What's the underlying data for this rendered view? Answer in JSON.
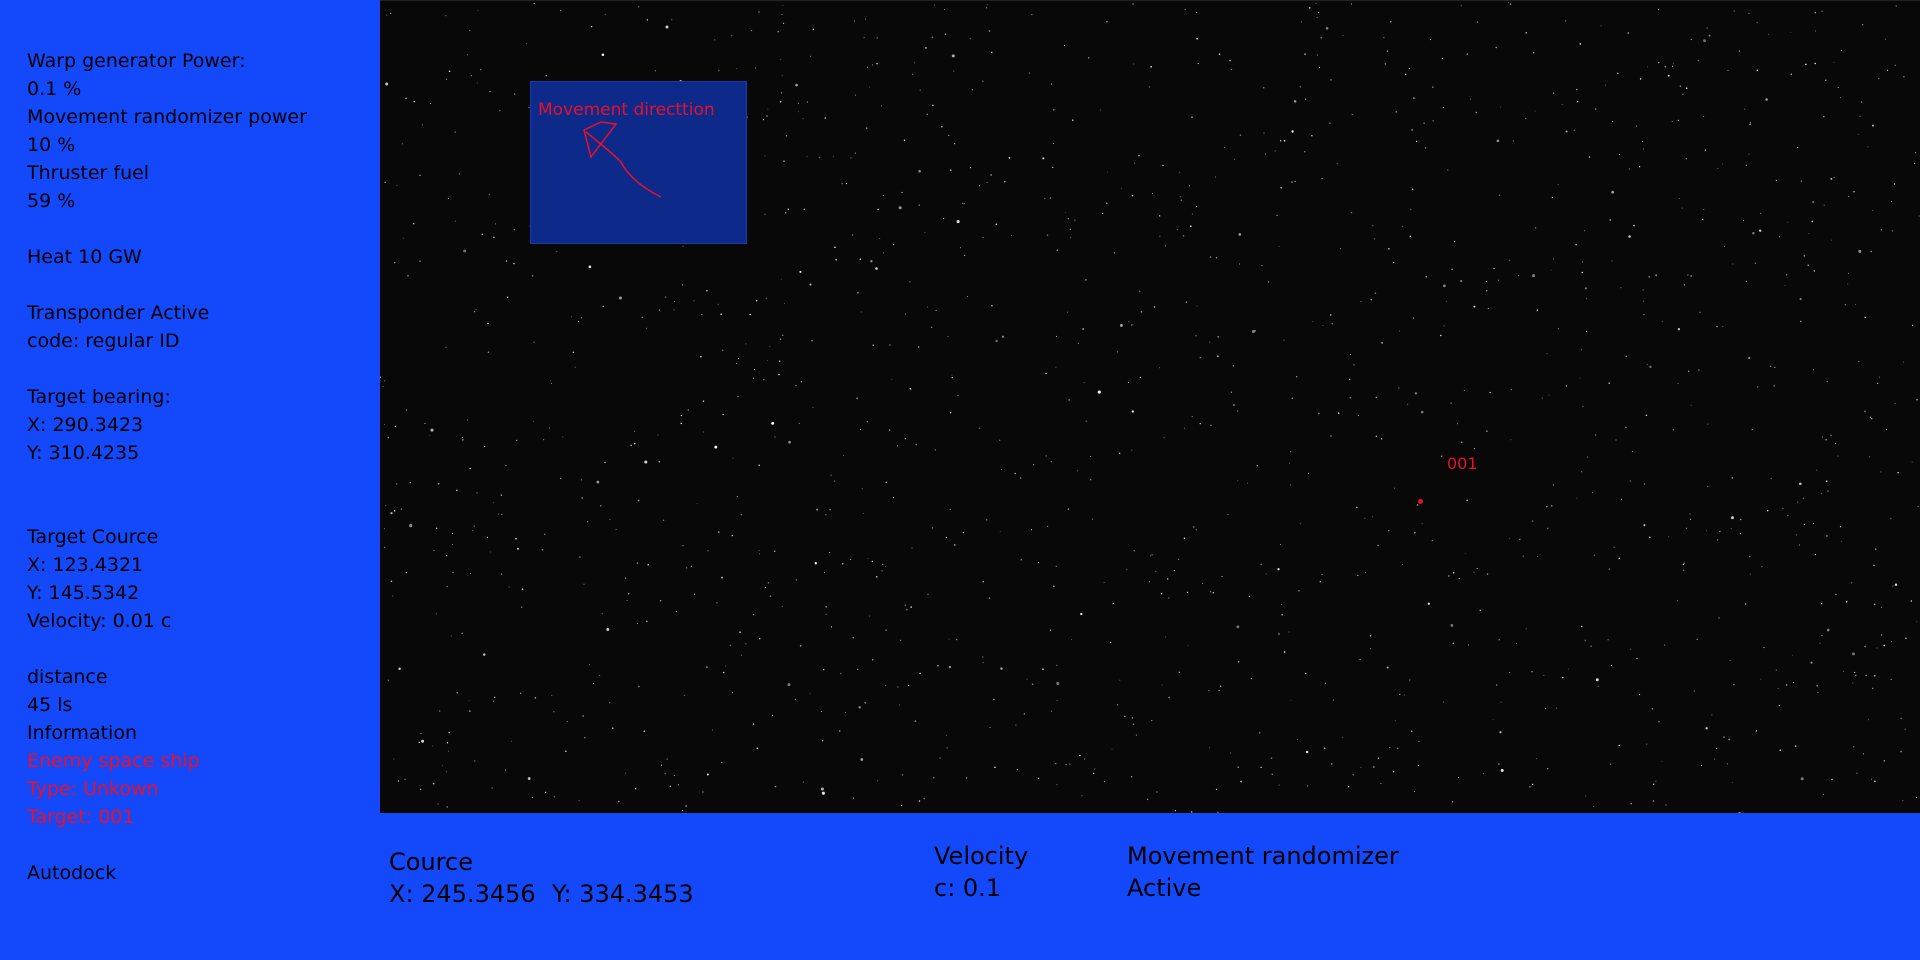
{
  "sidebar": {
    "warp_label": "Warp generator Power:",
    "warp_value": "0.1 %",
    "randomizer_label": "Movement randomizer power",
    "randomizer_value": "10 %",
    "fuel_label": "Thruster fuel",
    "fuel_value": "59 %",
    "heat": "Heat 10 GW",
    "transponder": "Transponder Active",
    "transponder_code": "code: regular ID",
    "bearing_label": "Target bearing:",
    "bearing_x": "X: 290.3423",
    "bearing_y": "Y: 310.4235",
    "course_label": "Target Cource",
    "course_x": "X: 123.4321",
    "course_y": "Y: 145.5342",
    "course_velocity": "Velocity: 0.01 c",
    "distance_label": "distance",
    "distance_value": "45 ls",
    "info_label": "Information",
    "info_ship": "Enemy space ship",
    "info_type": "Type: Unkown",
    "info_target": "Target: 001",
    "autodock": "Autodock"
  },
  "viewport": {
    "direction_title": "Movement directtion",
    "target_id": "001"
  },
  "bottom": {
    "course_label": "Cource",
    "course_x": "X: 245.3456",
    "course_y": "Y: 334.3453",
    "velocity_label": "Velocity",
    "velocity_value": "c: 0.1",
    "randomizer_label": "Movement randomizer",
    "randomizer_value": "Active"
  },
  "colors": {
    "panel_blue": "#1448fb",
    "space": "#080808",
    "alert_red": "#e8102a"
  }
}
